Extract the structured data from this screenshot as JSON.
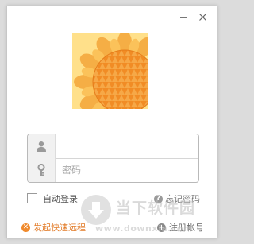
{
  "window": {
    "minimize_icon": "minimize-icon",
    "close_icon": "close-icon"
  },
  "logo": {
    "icon": "sunflower-logo",
    "colors": {
      "background": "#ffe08a",
      "petal": "#f4a63a",
      "center": "#f08a24"
    }
  },
  "login": {
    "user_icon": "user-icon",
    "password_icon": "key-icon",
    "username_value": "",
    "password_placeholder": "密码"
  },
  "options": {
    "auto_login_label": "自动登录",
    "auto_login_checked": false,
    "forgot_password_label": "忘记密码"
  },
  "footer": {
    "remote_assist_label": "发起快速远程",
    "register_label": "注册帐号",
    "accent_color": "#e27a26"
  },
  "watermark": {
    "title": "当下软件园",
    "subtitle": "www.downxia.com"
  }
}
